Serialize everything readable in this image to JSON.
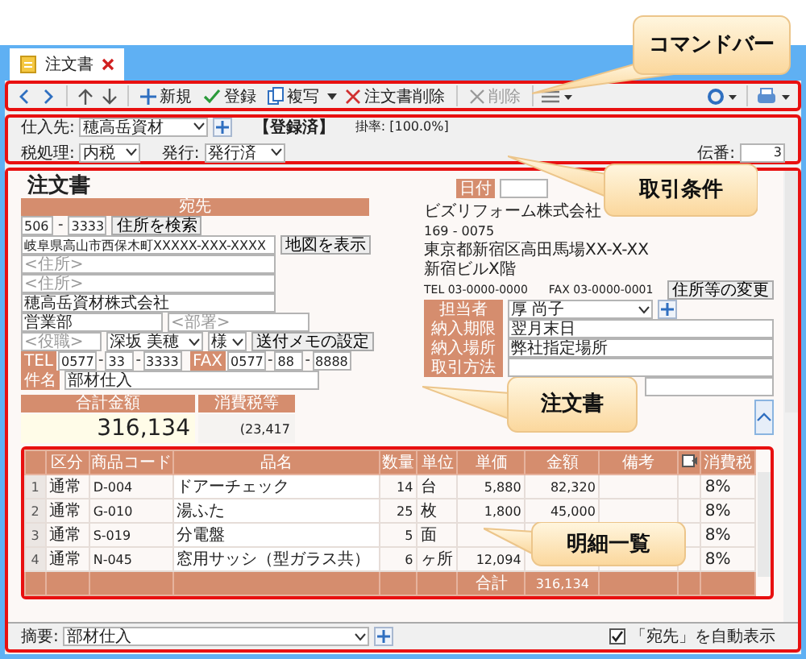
{
  "tab": {
    "title": "注文書"
  },
  "toolbar": {
    "new": "新規",
    "save": "登録",
    "copy": "複写",
    "delete_order": "注文書削除",
    "delete": {
      "label": "削除",
      "disabled": true
    }
  },
  "conditions": {
    "supplier_label": "仕入先:",
    "supplier": "穂高岳資材",
    "status": "【登録済】",
    "rate": "掛率: [100.0%]",
    "tax_label": "税処理:",
    "tax": "内税",
    "issue_label": "発行:",
    "issue": "発行済",
    "slip_label": "伝番:",
    "slip": "3"
  },
  "recipient": {
    "title": "注文書",
    "header": "宛先",
    "sep": "-",
    "postal": [
      "506",
      "3333"
    ],
    "search_button": "住所を検索",
    "address": "岐阜県高山市西保木町XXXXX-XXX-XXXX",
    "map_button": "地図を表示",
    "address2_placeholder": "<住所>",
    "address3_placeholder": "<住所>",
    "company": "穂高岳資材株式会社",
    "department": "営業部",
    "division_placeholder": "<部署>",
    "position_placeholder": "<役職>",
    "person": "深坂 美穂",
    "honorific": "様",
    "memo_button": "送付メモの設定",
    "tel_label": "TEL",
    "tel": [
      "0577",
      "33",
      "3333"
    ],
    "fax_label": "FAX",
    "fax": [
      "0577",
      "88",
      "8888"
    ],
    "subject_label": "件名",
    "subject": "部材仕入",
    "total_label": "合計金額",
    "total": "316,134",
    "tax_label": "消費税等",
    "tax": "(23,417"
  },
  "sender": {
    "date_label": "日付",
    "company": "ビズリフォーム株式会社",
    "postal": "169 - 0075",
    "address": "東京都新宿区高田馬場XX-X-XX",
    "building": "新宿ビルX階",
    "tel": "TEL 03-0000-0000",
    "fax": "FAX 03-0000-0001",
    "change_button": "住所等の変更",
    "fields": [
      {
        "kind": "select",
        "label": "担当者",
        "value": "厚 尚子"
      },
      {
        "kind": "text",
        "label": "納入期限",
        "value": "翌月末日"
      },
      {
        "kind": "text",
        "label": "納入場所",
        "value": "弊社指定場所"
      },
      {
        "kind": "text",
        "label": "取引方法"
      },
      {
        "kind": "text"
      }
    ]
  },
  "table": {
    "columns": [
      {
        "kind": "text",
        "label": "区分"
      },
      {
        "kind": "text",
        "label": "商品コード"
      },
      {
        "kind": "text",
        "label": "品名"
      },
      {
        "kind": "text",
        "label": "数量"
      },
      {
        "kind": "text",
        "label": "単位"
      },
      {
        "kind": "text",
        "label": "単価"
      },
      {
        "kind": "text",
        "label": "金額"
      },
      {
        "kind": "text",
        "label": "備考"
      },
      {
        "kind": "icon"
      },
      {
        "kind": "text",
        "label": "消費税"
      }
    ],
    "rows": [
      {
        "no": "1",
        "category": "通常",
        "code": "D-004",
        "name": "ドアーチェック",
        "qty": "14",
        "unit": "台",
        "price": "5,880",
        "amount": "82,320",
        "tax": "8%"
      },
      {
        "no": "2",
        "category": "通常",
        "code": "G-010",
        "name": "湯ふた",
        "qty": "25",
        "unit": "枚",
        "price": "1,800",
        "amount": "45,000",
        "tax": "8%"
      },
      {
        "no": "3",
        "category": "通常",
        "code": "S-019",
        "name": "分電盤",
        "qty": "5",
        "unit": "面",
        "tax": "8%"
      },
      {
        "no": "4",
        "category": "通常",
        "code": "N-045",
        "name": "窓用サッシ（型ガラス共）",
        "qty": "6",
        "unit": "ヶ所",
        "price": "12,094",
        "tax": "8%"
      }
    ],
    "total": {
      "label": "合計",
      "amount": "316,134"
    }
  },
  "footer": {
    "summary_label": "摘要:",
    "summary": "部材仕入",
    "auto_label": "「宛先」を自動表示",
    "auto_checked": true
  },
  "callouts": [
    "コマンドバー",
    "取引条件",
    "注文書",
    "明細一覧"
  ]
}
